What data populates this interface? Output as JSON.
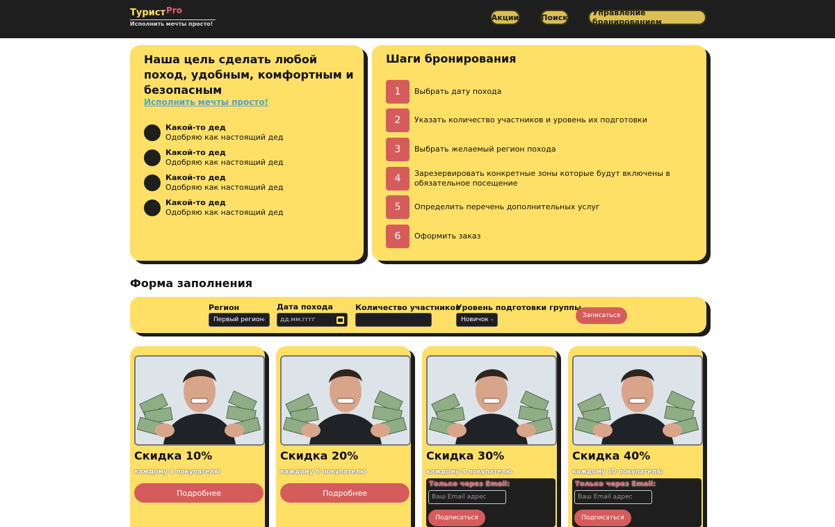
{
  "header": {
    "logo_title": "Турист",
    "logo_pro": "Pro",
    "logo_sub": "Исполнить мечты просто!",
    "nav": [
      "Акции",
      "Поиск",
      "Управление бранированием"
    ]
  },
  "goal": {
    "title": "Наша цель сделать любой поход, удобным, комфортным и безопасным",
    "link": "Исполнить мечты просто!",
    "reviews": [
      {
        "name": "Какой-то дед",
        "text": "Одобряю как настоящий дед"
      },
      {
        "name": "Какой-то дед",
        "text": "Одобряю как настоящий дед"
      },
      {
        "name": "Какой-то дед",
        "text": "Одобряю как настоящий дед"
      },
      {
        "name": "Какой-то дед",
        "text": "Одобряю как настоящий дед"
      }
    ]
  },
  "steps": {
    "title": "Шаги бронирования",
    "items": [
      {
        "num": "1",
        "text": "Выбрать дату похода"
      },
      {
        "num": "2",
        "text": "Указать количество участников и уровень их подготовки"
      },
      {
        "num": "3",
        "text": "Выбрать желаемый регион похода"
      },
      {
        "num": "4",
        "text": "Зарезервировать конкретные зоны которые будут включены в обязательное посещение"
      },
      {
        "num": "5",
        "text": "Определить перечень дополнительных услуг"
      },
      {
        "num": "6",
        "text": "Оформить заказ"
      }
    ]
  },
  "form": {
    "title": "Форма заполнения",
    "region_label": "Регион",
    "region_value": "Первый регион",
    "date_label": "Дата похода",
    "date_placeholder": "дд.мм.гггг",
    "count_label": "Количество участников",
    "level_label": "Уровень подготовки группы",
    "level_value": "Новичок",
    "submit": "Записаться"
  },
  "promos": [
    {
      "title": "Скидка 10%",
      "sub": "каждому 4 покупателю",
      "button": "Подробнее"
    },
    {
      "title": "Скидка 20%",
      "sub": "каждому 6 покупателю",
      "button": "Подробнее"
    },
    {
      "title": "Скидка 30%",
      "sub": "каждому 8 покупателю",
      "email_label": "Только через Email:",
      "email_placeholder": "Ваш Email адрес",
      "email_button": "Подписаться"
    },
    {
      "title": "Скидка 40%",
      "sub": "каждому 10 покупателю",
      "email_label": "Только через Email:",
      "email_placeholder": "Ваш Email адрес",
      "email_button": "Подписаться"
    }
  ],
  "colors": {
    "header_bg": "#1e1e1e",
    "accent_yellow": "#ffe066",
    "accent_red": "#d65c5c",
    "link_blue": "#4aa6c8"
  },
  "icons": {
    "chevron": "chevron-down-icon",
    "calendar": "calendar-icon"
  }
}
